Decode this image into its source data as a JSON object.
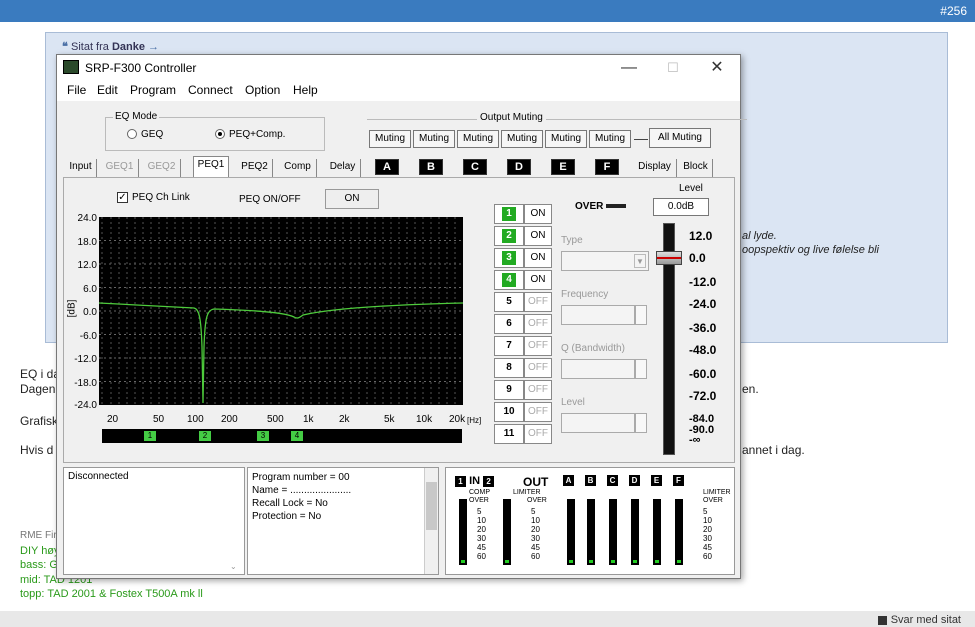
{
  "forum": {
    "post_number": "#256",
    "quote_prefix": "Sitat fra",
    "quote_author": "Danke",
    "quote_right_1": "al lyde.",
    "quote_right_2": "oopspektiv og live følelse bli",
    "body_1": "EQ i da",
    "body_2": "Dagen",
    "body_2_right": "en.",
    "body_3": "Grafisk",
    "body_4": "Hvis d",
    "body_4_right": "annet i dag.",
    "sig_1": "RME Fir",
    "sig_2": "DIY høy",
    "sig_3": "bass: GF",
    "sig_4": "mid: TAD 1201",
    "sig_5": "topp: TAD 2001 & Fostex T500A mk ll",
    "reply_label": "Svar med sitat"
  },
  "window": {
    "title": "SRP-F300 Controller",
    "min": "—",
    "max": "☐",
    "close": "✕",
    "menu": [
      "File",
      "Edit",
      "Program",
      "Connect",
      "Option",
      "Help"
    ]
  },
  "eq_mode": {
    "legend": "EQ Mode",
    "options": [
      "GEQ",
      "PEQ+Comp."
    ],
    "selected": "PEQ+Comp."
  },
  "output_muting": {
    "legend": "Output Muting",
    "button": "Muting",
    "all": "All Muting"
  },
  "tabs": [
    "Input",
    "GEQ1",
    "GEQ2",
    "PEQ1",
    "PEQ2",
    "Comp",
    "Delay"
  ],
  "active_tab": "PEQ1",
  "channel_tabs": [
    "A",
    "B",
    "C",
    "D",
    "E",
    "F"
  ],
  "right_tabs": [
    "Display",
    "Block"
  ],
  "peq": {
    "ch_link": "PEQ Ch Link",
    "onoff_label": "PEQ ON/OFF",
    "onoff_value": "ON",
    "over": "OVER",
    "level_label": "Level",
    "level_value": "0.0dB",
    "y_unit": "[dB]",
    "x_unit": "[Hz]",
    "y_ticks": [
      "24.0",
      "18.0",
      "12.0",
      "6.0",
      "0.0",
      "-6.0",
      "-12.0",
      "-18.0",
      "-24.0"
    ],
    "x_ticks": [
      "20",
      "50",
      "100",
      "200",
      "500",
      "1k",
      "2k",
      "5k",
      "10k",
      "20k"
    ],
    "markers": [
      "1",
      "2",
      "3",
      "4"
    ],
    "bands": [
      {
        "num": "1",
        "state": "ON",
        "active": true
      },
      {
        "num": "2",
        "state": "ON",
        "active": true
      },
      {
        "num": "3",
        "state": "ON",
        "active": true
      },
      {
        "num": "4",
        "state": "ON",
        "active": true
      },
      {
        "num": "5",
        "state": "OFF",
        "active": false
      },
      {
        "num": "6",
        "state": "OFF",
        "active": false
      },
      {
        "num": "7",
        "state": "OFF",
        "active": false
      },
      {
        "num": "8",
        "state": "OFF",
        "active": false
      },
      {
        "num": "9",
        "state": "OFF",
        "active": false
      },
      {
        "num": "10",
        "state": "OFF",
        "active": false
      },
      {
        "num": "11",
        "state": "OFF",
        "active": false
      }
    ],
    "type_label": "Type",
    "freq_label": "Frequency",
    "q_label": "Q (Bandwidth)",
    "lvl_label": "Level",
    "slider_scale": [
      "12.0",
      "0.0",
      "-12.0",
      "-24.0",
      "-36.0",
      "-48.0",
      "-60.0",
      "-72.0",
      "-84.0",
      "-90.0",
      "-∞"
    ],
    "slider_level": "0.0"
  },
  "status": {
    "connection": "Disconnected",
    "program": "Program number = 00",
    "name": "Name = ......................",
    "recall": "Recall Lock = No",
    "protection": "Protection = No"
  },
  "meters": {
    "in_label": "IN",
    "in_a": "1",
    "in_b": "2",
    "out_label": "OUT",
    "comp": "COMP",
    "limiter": "LIMITER",
    "over": "OVER",
    "scale": [
      "5",
      "10",
      "20",
      "30",
      "45",
      "60"
    ],
    "in_scale": [
      "5",
      "10",
      "20",
      "30",
      "45",
      "60"
    ]
  }
}
